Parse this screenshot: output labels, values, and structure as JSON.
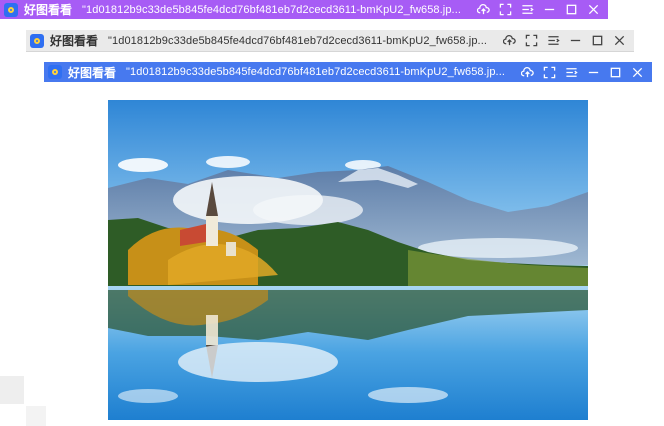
{
  "windows": [
    {
      "app_name": "好图看看",
      "file_title": "\"1d01812b9c33de5b845fe4dcd76bf481eb7d2cecd3611-bmKpU2_fw658.jp...",
      "accent": "#a75cf5"
    },
    {
      "app_name": "好图看看",
      "file_title": "\"1d01812b9c33de5b845fe4dcd76bf481eb7d2cecd3611-bmKpU2_fw658.jp...",
      "accent": "#eaeaea"
    },
    {
      "app_name": "好图看看",
      "file_title": "\"1d01812b9c33de5b845fe4dcd76bf481eb7d2cecd3611-bmKpU2_fw658.jp...",
      "accent": "#4779ef"
    }
  ],
  "controls": [
    "upload-icon",
    "fullscreen-icon",
    "menu-icon",
    "minimize-icon",
    "maximize-icon",
    "close-icon"
  ],
  "image": {
    "subject": "lake-church-island-mountains-reflection"
  }
}
